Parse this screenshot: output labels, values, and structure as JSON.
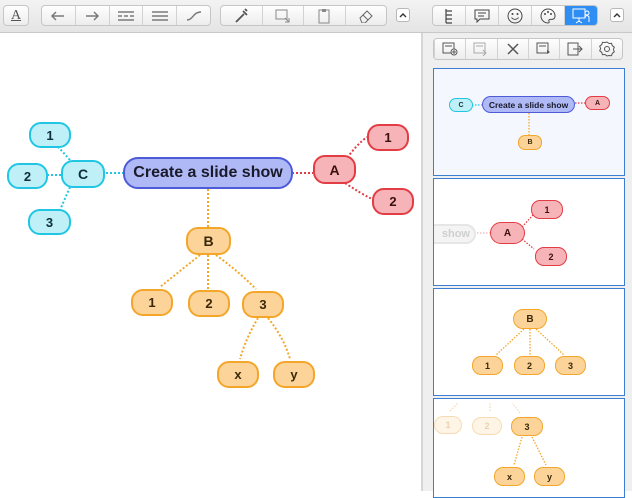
{
  "toolbar": {
    "text_style_label": "A",
    "left_icons": [
      "text-style-icon"
    ],
    "nav_icons": [
      "arrow-left-icon",
      "arrow-right-icon",
      "layout-structure-icon",
      "list-icon",
      "curve-icon"
    ],
    "tool_icons": [
      "eyedropper-icon",
      "image-insert-icon",
      "clipboard-icon",
      "eraser-icon"
    ],
    "panel_tabs": [
      "outline-icon",
      "comment-icon",
      "emoji-icon",
      "palette-icon",
      "presentation-icon"
    ]
  },
  "panel_toolbar": {
    "icons": [
      "add-slide-icon",
      "duplicate-slide-icon",
      "delete-icon",
      "slide-export-icon",
      "share-icon",
      "settings-icon"
    ]
  },
  "mindmap": {
    "root": "Create a slide show",
    "a": {
      "label": "A",
      "children": [
        "1",
        "2"
      ]
    },
    "b": {
      "label": "B",
      "children": [
        "1",
        "2",
        "3"
      ],
      "grandchildren": [
        "x",
        "y"
      ]
    },
    "c": {
      "label": "C",
      "children": [
        "1",
        "2",
        "3"
      ]
    }
  },
  "slides": {
    "s1": {
      "root": "Create a slide show",
      "left": "C",
      "right": "A",
      "bottom": "B"
    },
    "s2": {
      "partial": "show",
      "center": "A",
      "c1": "1",
      "c2": "2"
    },
    "s3": {
      "center": "B",
      "c1": "1",
      "c2": "2",
      "c3": "3"
    },
    "s4": {
      "ghost1": "1",
      "ghost2": "2",
      "center": "3",
      "c1": "x",
      "c2": "y"
    }
  },
  "colors": {
    "accent": "#2f8ef4",
    "root_fill": "#aeb9f5",
    "root_border": "#4d5bd9",
    "red_fill": "#f7b4b8",
    "red_border": "#e23c44",
    "blue_fill": "#bff0f8",
    "blue_border": "#20c6e4",
    "orange_fill": "#fcd49a",
    "orange_border": "#f3a62a"
  }
}
